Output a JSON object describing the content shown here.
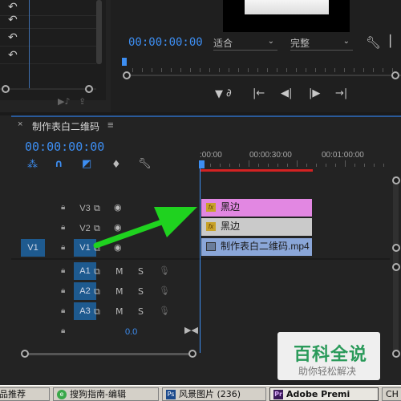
{
  "program_monitor": {
    "timecode": "00:00:00:00",
    "fit_select": "适合",
    "quality_select": "完整"
  },
  "timeline": {
    "title": "制作表白二维码",
    "menu_glyph": "≡",
    "close_glyph": "×",
    "timecode": "00:00:00:00",
    "ruler_labels": [
      ":00:00",
      "00:00:30:00",
      "00:01:00:00"
    ],
    "tracks": {
      "V3": "V3",
      "V2": "V2",
      "V1": "V1",
      "source_v1": "V1",
      "A1": "A1",
      "A2": "A2",
      "A3": "A3"
    },
    "mute_label": "M",
    "solo_label": "S",
    "master_volume": "0.0",
    "clips": {
      "v3": "黑边",
      "v2": "黑边",
      "v1": "制作表白二维码.mp4"
    },
    "colors": {
      "v3_clip": "#e287e2",
      "v2_clip": "#cacaca",
      "v1_clip": "#8aa6d8",
      "accent": "#3d8ef2",
      "arrow": "#1fd21f"
    }
  },
  "watermark": {
    "title": "百科全说",
    "subtitle": "助你轻松解决"
  },
  "taskbar": {
    "items": [
      "品推荐",
      "搜狗指南-编辑",
      "风景图片 (236)",
      "Adobe Premi",
      "CH"
    ]
  }
}
